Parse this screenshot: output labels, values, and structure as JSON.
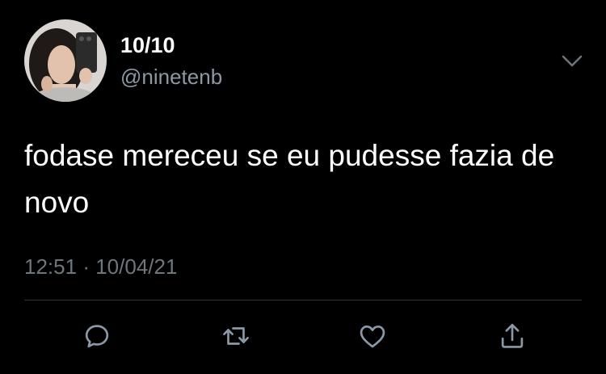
{
  "tweet": {
    "display_name": "10/10",
    "handle": "@ninetenb",
    "text": "fodase mereceu se eu pudesse fazia de novo",
    "time": "12:51",
    "separator": "·",
    "date": "10/04/21"
  },
  "icons": {
    "more": "chevron-down-icon",
    "reply": "reply-icon",
    "retweet": "retweet-icon",
    "like": "heart-icon",
    "share": "share-icon"
  },
  "colors": {
    "background": "#000000",
    "text": "#ffffff",
    "secondary": "#8b98a5",
    "icon": "#8b98a5",
    "divider": "#2f3336"
  }
}
